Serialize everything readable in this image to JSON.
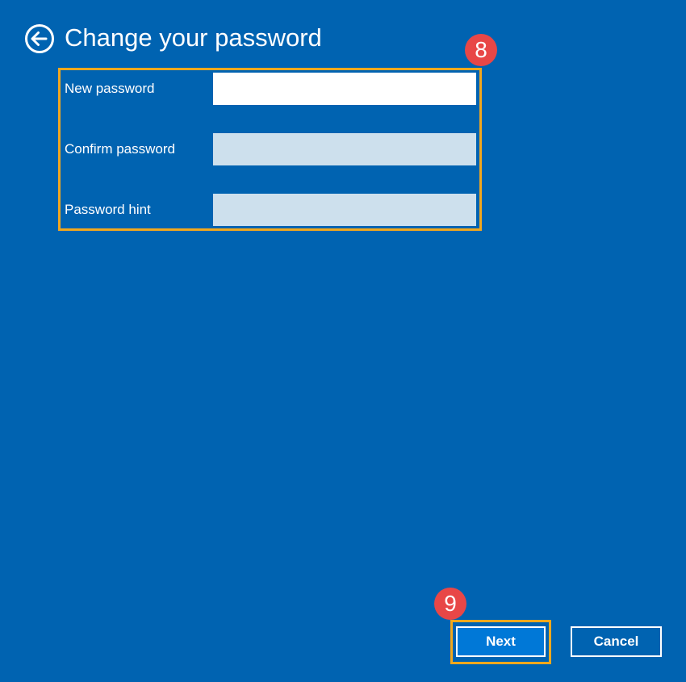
{
  "header": {
    "title": "Change your password",
    "back_icon": "back-arrow-circle-icon"
  },
  "form": {
    "fields": [
      {
        "label": "New password",
        "value": "",
        "state": "active"
      },
      {
        "label": "Confirm password",
        "value": "",
        "state": "inactive"
      },
      {
        "label": "Password hint",
        "value": "",
        "state": "inactive"
      }
    ]
  },
  "annotations": {
    "form_step": "8",
    "next_step": "9"
  },
  "buttons": {
    "next_label": "Next",
    "cancel_label": "Cancel"
  },
  "colors": {
    "background": "#0063b1",
    "highlight": "#f2a81d",
    "callout": "#e84747",
    "next_button": "#0078d7",
    "inactive_input": "#cde0ed"
  }
}
